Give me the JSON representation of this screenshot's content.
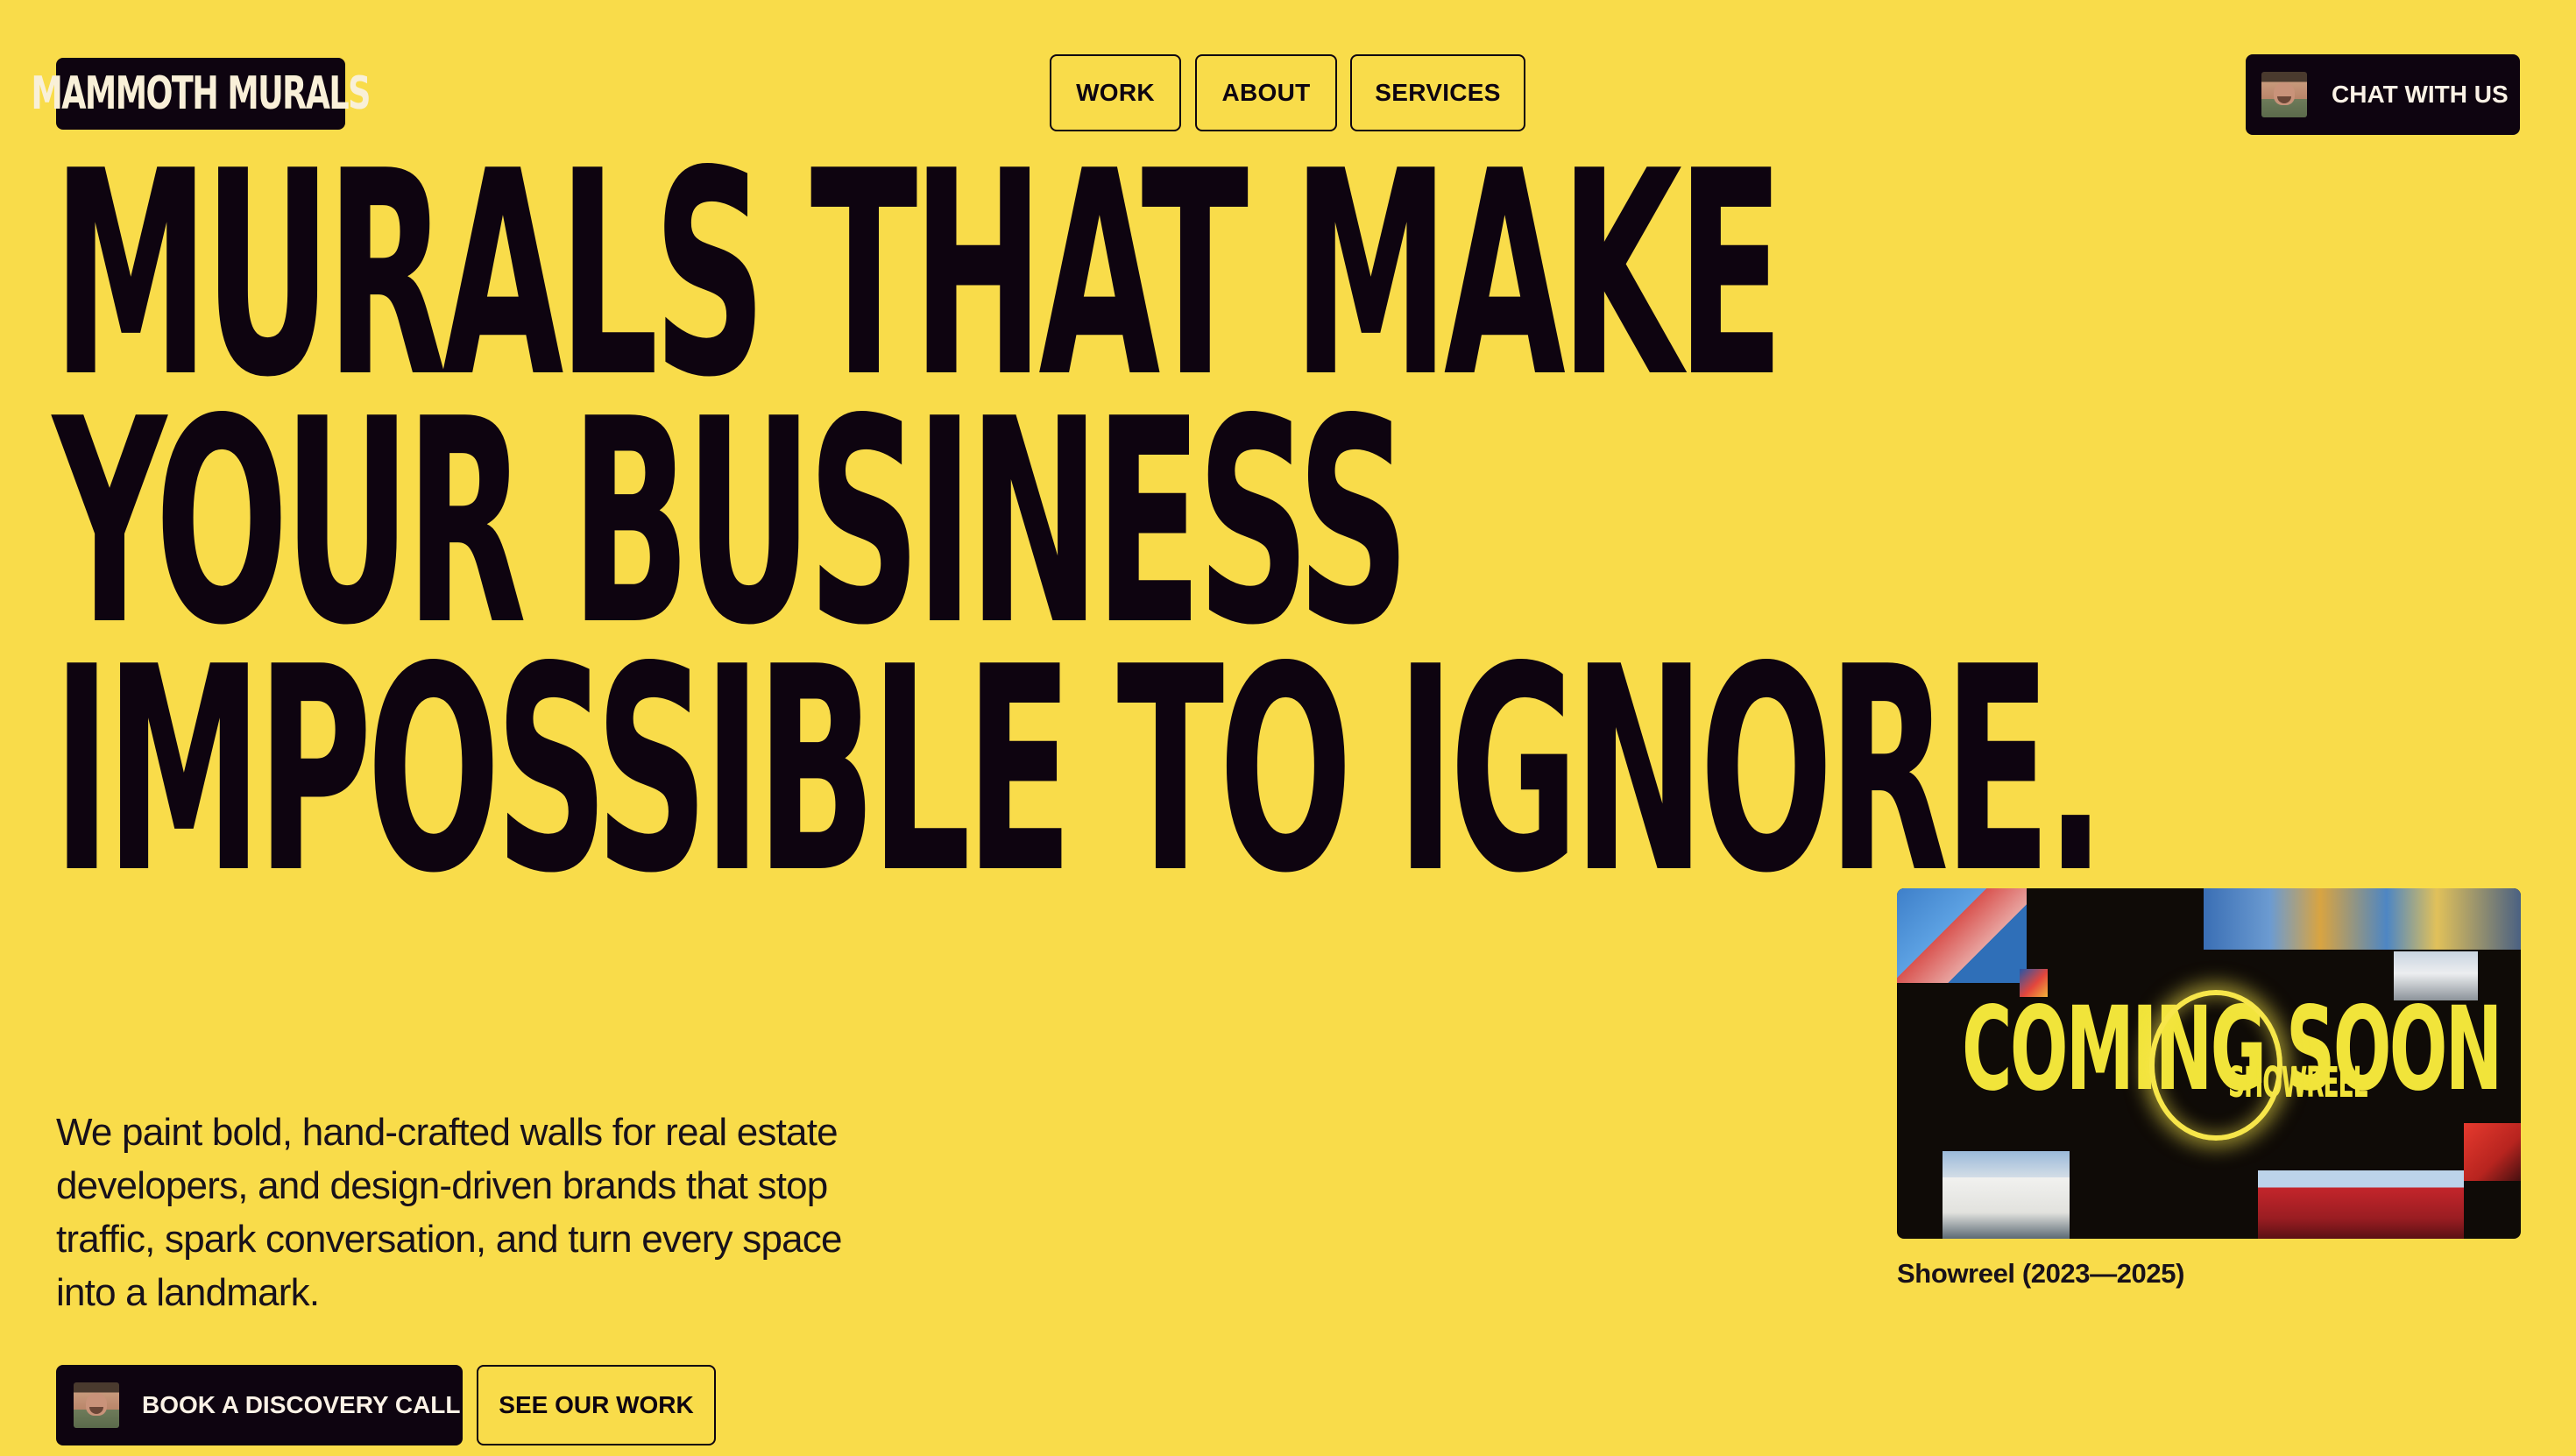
{
  "brand": {
    "logo_text": "MAMMOTH MURALS"
  },
  "nav": {
    "items": [
      {
        "label": "WORK"
      },
      {
        "label": "ABOUT"
      },
      {
        "label": "SERVICES"
      }
    ]
  },
  "header": {
    "chat_label": "CHAT WITH US",
    "chat_icon": "avatar-photo"
  },
  "hero": {
    "headline_lines": [
      "MURALS THAT MAKE",
      "YOUR BUSINESS",
      "IMPOSSIBLE TO IGNORE."
    ],
    "body": "We paint bold, hand-crafted walls for real estate developers, and design-driven brands that stop traffic, spark conversation, and turn every space into a landmark.",
    "primary_cta": "BOOK A DISCOVERY CALL",
    "secondary_cta": "SEE OUR WORK"
  },
  "showreel": {
    "overlay_title": "COMING SOON",
    "overlay_subtitle": "SHOWREEL",
    "caption": "Showreel (2023—2025)"
  },
  "colors": {
    "background": "#f9dc4a",
    "ink": "#0e0410",
    "accent": "#f1e43a"
  }
}
